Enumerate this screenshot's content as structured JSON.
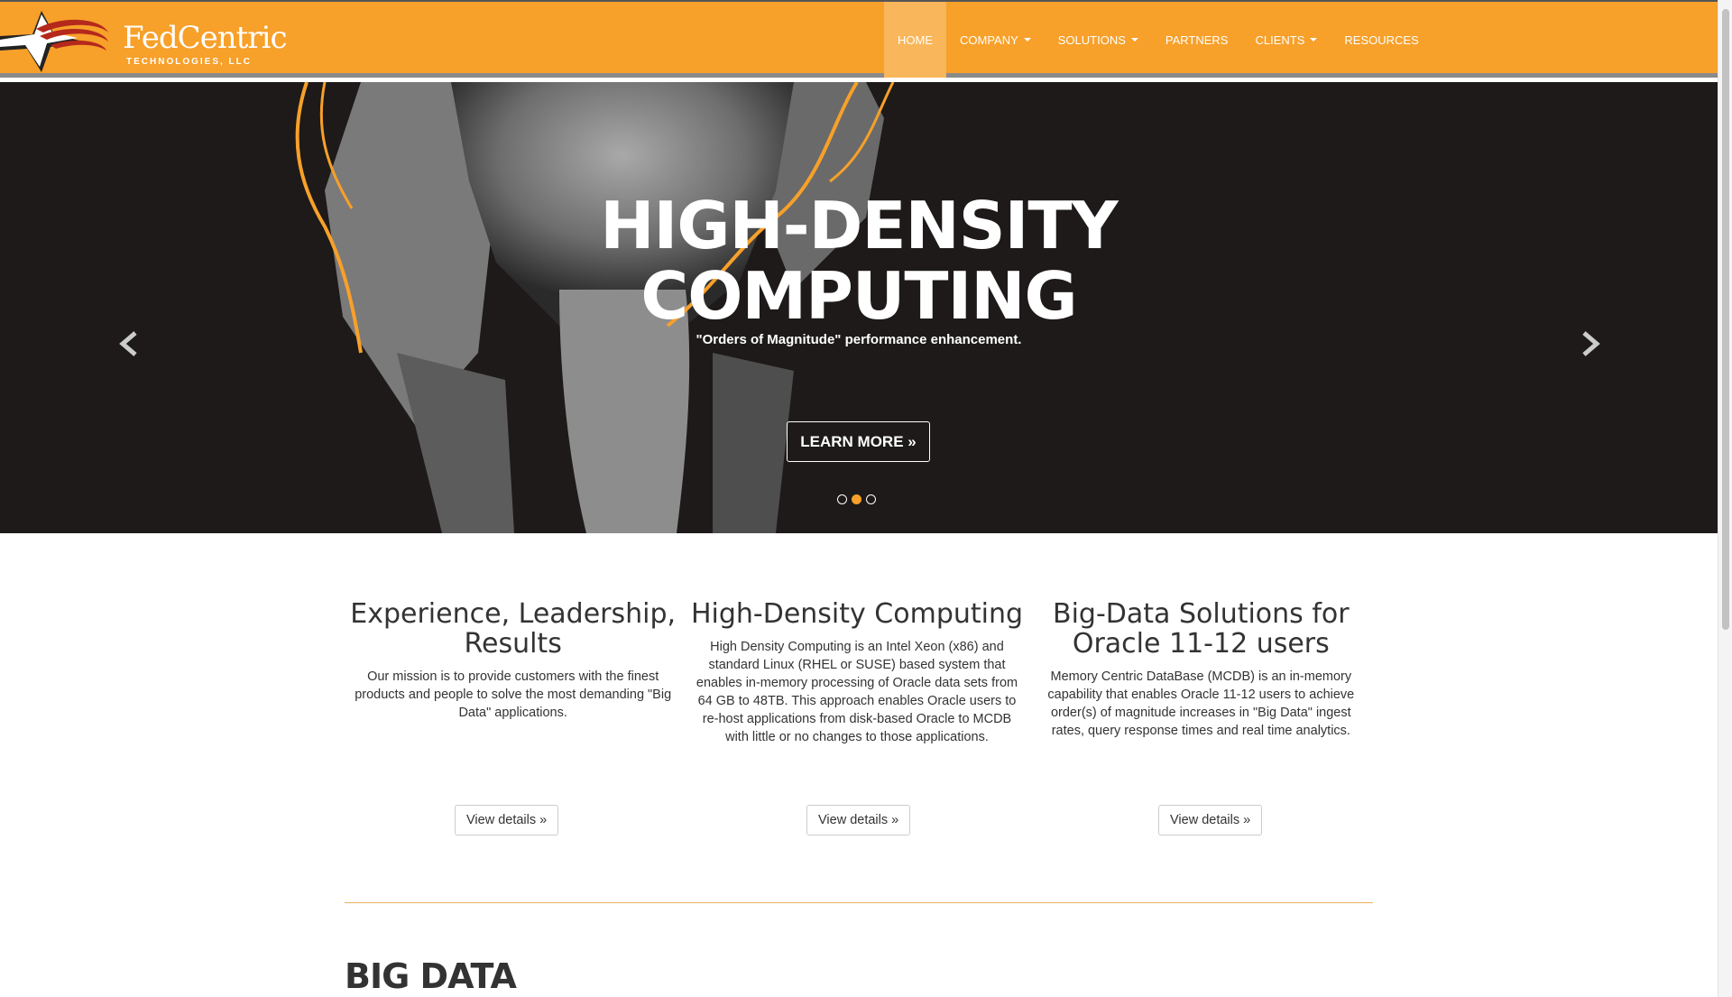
{
  "brand": {
    "name": "FedCentric",
    "sub": "TECHNOLOGIES, LLC"
  },
  "nav": {
    "items": [
      {
        "label": "HOME",
        "active": true,
        "dropdown": false
      },
      {
        "label": "COMPANY",
        "dropdown": true
      },
      {
        "label": "SOLUTIONS",
        "dropdown": true
      },
      {
        "label": "PARTNERS",
        "dropdown": false
      },
      {
        "label": "CLIENTS",
        "dropdown": true
      },
      {
        "label": "RESOURCES",
        "dropdown": false
      }
    ]
  },
  "hero": {
    "title_line1": "HIGH-DENSITY",
    "title_line2": "COMPUTING",
    "subtitle": "\"Orders of Magnitude\" performance enhancement.",
    "button": "LEARN MORE »",
    "slides": 3,
    "active_slide": 2
  },
  "columns": [
    {
      "title": "Experience, Leadership, Results",
      "text": "Our mission is to provide customers with the finest products and people to solve the most demanding \"Big Data\" applications.",
      "button": "View details »"
    },
    {
      "title": "High-Density Computing",
      "text": "High Density Computing is an Intel Xeon (x86) and standard Linux (RHEL or SUSE) based system that enables in-memory processing of Oracle data sets from 64 GB to 48TB. This approach enables Oracle users to re-host applications from disk-based Oracle to MCDB with little or no changes to those applications.",
      "button": "View details »"
    },
    {
      "title": "Big-Data Solutions for Oracle 11-12 users",
      "text": "Memory Centric DataBase (MCDB) is an in-memory capability that enables Oracle 11-12 users to achieve order(s) of magnitude increases in \"Big Data\" ingest rates, query response times and real time analytics.",
      "button": "View details »"
    }
  ],
  "section": {
    "title": "BIG DATA"
  },
  "colors": {
    "accent": "#f7a02a",
    "hero_bg": "#1d1a19"
  }
}
